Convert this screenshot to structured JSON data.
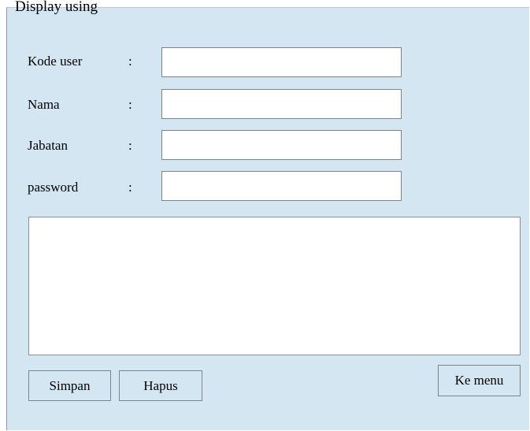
{
  "header_text": "Display using",
  "form": {
    "fields": [
      {
        "label": "Kode user",
        "colon": ":",
        "value": ""
      },
      {
        "label": "Nama",
        "colon": ":",
        "value": ""
      },
      {
        "label": "Jabatan",
        "colon": ":",
        "value": ""
      },
      {
        "label": "password",
        "colon": ":",
        "value": ""
      }
    ],
    "output_text": ""
  },
  "buttons": {
    "save_label": "Simpan",
    "delete_label": "Hapus",
    "menu_label": "Ke menu"
  },
  "colors": {
    "panel_background": "#d4e6f2",
    "field_background": "#ffffff",
    "border": "#7c848a"
  }
}
